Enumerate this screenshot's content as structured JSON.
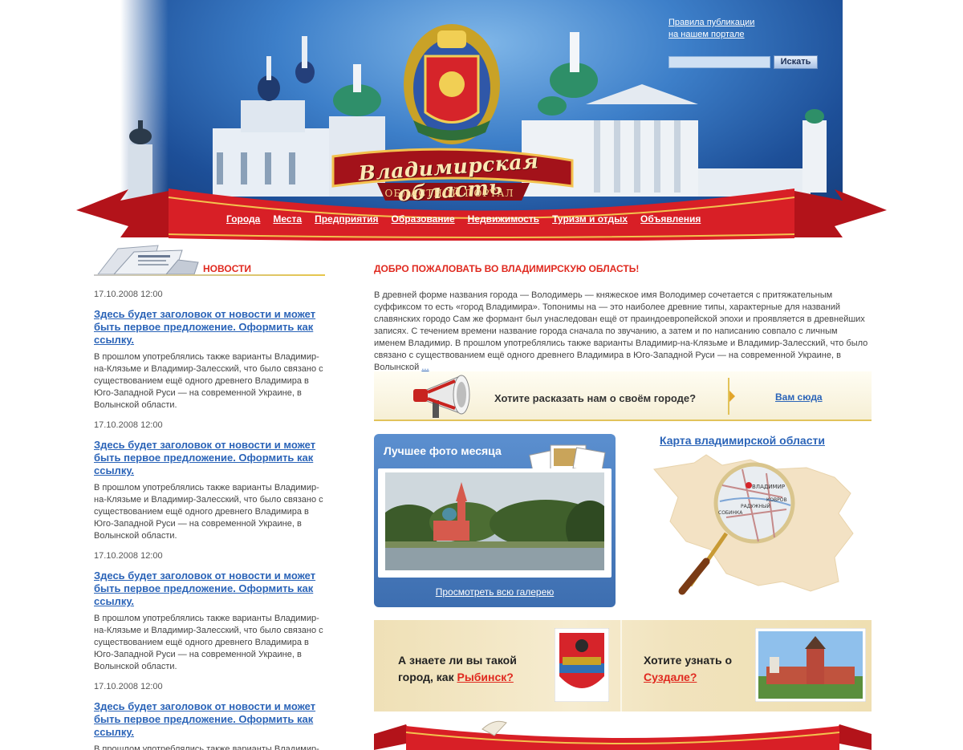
{
  "header": {
    "logo_title": "Владимирская область",
    "logo_subtitle": "ОБЛАСТНОЙ ПОРТАЛ",
    "publication_rules_line1": "Правила публикации",
    "publication_rules_line2": "на нашем портале",
    "search": {
      "value": "",
      "button_label": "Искать"
    },
    "nav": [
      "Города",
      "Места",
      "Предприятия",
      "Образование",
      "Недвижимость",
      "Туризм и отдых",
      "Объявления"
    ]
  },
  "news": {
    "title": "НОВОСТИ",
    "items": [
      {
        "date": "17.10.2008 12:00",
        "headline": "Здесь будет заголовок от новости и может быть первое предложение. Оформить как ссылку.",
        "text": "В прошлом употреблялись также варианты Владимир-на-Клязьме и Владимир-Залесский, что было связано с существованием ещё одного древнего Владимира в Юго-Западной Руси — на современной Украине, в Волынской области."
      },
      {
        "date": "17.10.2008 12:00",
        "headline": "Здесь будет заголовок от новости и может быть первое предложение. Оформить как ссылку.",
        "text": "В прошлом употреблялись также варианты Владимир-на-Клязьме и Владимир-Залесский, что было связано с существованием ещё одного древнего Владимира в Юго-Западной Руси — на современной Украине, в Волынской области."
      },
      {
        "date": "17.10.2008 12:00",
        "headline": "Здесь будет заголовок от новости и может быть первое предложение. Оформить как ссылку.",
        "text": "В прошлом употреблялись также варианты Владимир-на-Клязьме и Владимир-Залесский, что было связано с существованием ещё одного древнего Владимира в Юго-Западной Руси — на современной Украине, в Волынской области."
      },
      {
        "date": "17.10.2008 12:00",
        "headline": "Здесь будет заголовок от новости и может быть первое предложение. Оформить как ссылку.",
        "text": "В прошлом употреблялись также варианты Владимир-"
      }
    ]
  },
  "welcome": {
    "title": "ДОБРО ПОЖАЛОВАТЬ ВО ВЛАДИМИРСКУЮ ОБЛАСТЬ!",
    "text": "В древней форме названия города — Володимерь — княжеское имя Володимер сочетается с притяжательным суффиксом то есть «город Владимира». Топонимы на — это наиболее древние типы, характерные для названий славянских городо Сам же формант был унаследован ещё от праиндоевропейской эпохи и проявляется в древнейших записях. С течением времени название города сначала по звучанию, а затем и по написанию совпало с личным именем Владимир. В прошлом употреблялись также варианты Владимир-на-Клязьме и Владимир-Залесский, что было связано с существованием ещё одного древнего Владимира в Юго-Западной Руси — на современной Украине, в Волынской",
    "more_label": "..."
  },
  "story": {
    "question": "Хотите расказать нам о своём городе?",
    "link": "Вам сюда"
  },
  "photo_of_month": {
    "title": "Лучшее фото месяца",
    "gallery_link": "Просмотреть всю галерею"
  },
  "map": {
    "title": "Карта владимирской области",
    "labels": [
      "ВЛАДИМИР",
      "КОВРОВ",
      "РАДУЖНЫЙ",
      "СОБИНКА"
    ]
  },
  "promo": {
    "left_line1": "А знаете ли вы такой",
    "left_line2_prefix": "город, как ",
    "left_city": "Рыбинск?",
    "right_line1": "Хотите узнать о",
    "right_city": "Суздале?"
  },
  "colors": {
    "accent_red": "#e0291f",
    "link_blue": "#2b64b8",
    "ribbon_red": "#c8161b",
    "gold": "#e2c35a",
    "photo_box_blue": "#4a7ec0"
  }
}
